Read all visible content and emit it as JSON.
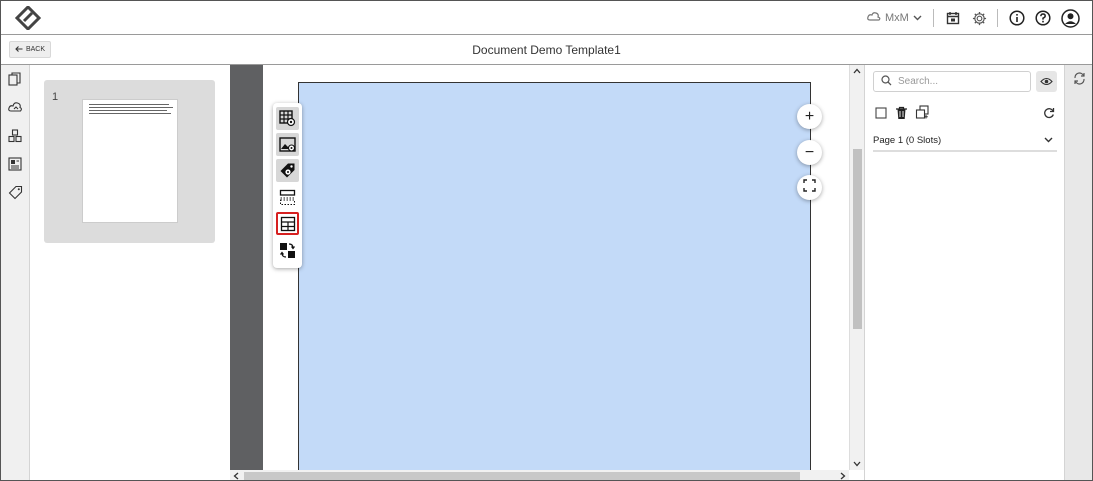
{
  "header": {
    "user_label": "MxM",
    "icons": [
      "logo-icon",
      "cloud-icon",
      "chevron-down-icon",
      "calendar-icon",
      "gear-icon",
      "info-icon",
      "help-icon",
      "profile-icon"
    ]
  },
  "subbar": {
    "back_label": "BACK",
    "title": "Document Demo Template1"
  },
  "left_rail": {
    "icons": [
      "pages-icon",
      "cloud-upload-icon",
      "boxes-icon",
      "layout-icon",
      "tag-icon"
    ]
  },
  "thumbnails": {
    "pages": [
      {
        "number": "1"
      }
    ]
  },
  "floating_tools": {
    "items": [
      "grid-view-tool",
      "image-view-tool",
      "tag-view-tool",
      "row-split-tool",
      "table-tool",
      "swap-tool"
    ],
    "active": "table-tool"
  },
  "zoom": {
    "in_label": "+",
    "out_label": "−"
  },
  "right_panel": {
    "search_placeholder": "Search...",
    "slot_header": "Page 1 (0 Slots)"
  },
  "colors": {
    "page_fill": "#c3daf8",
    "canvas_bg": "#5f6062",
    "active_tool_border": "#d62020"
  }
}
